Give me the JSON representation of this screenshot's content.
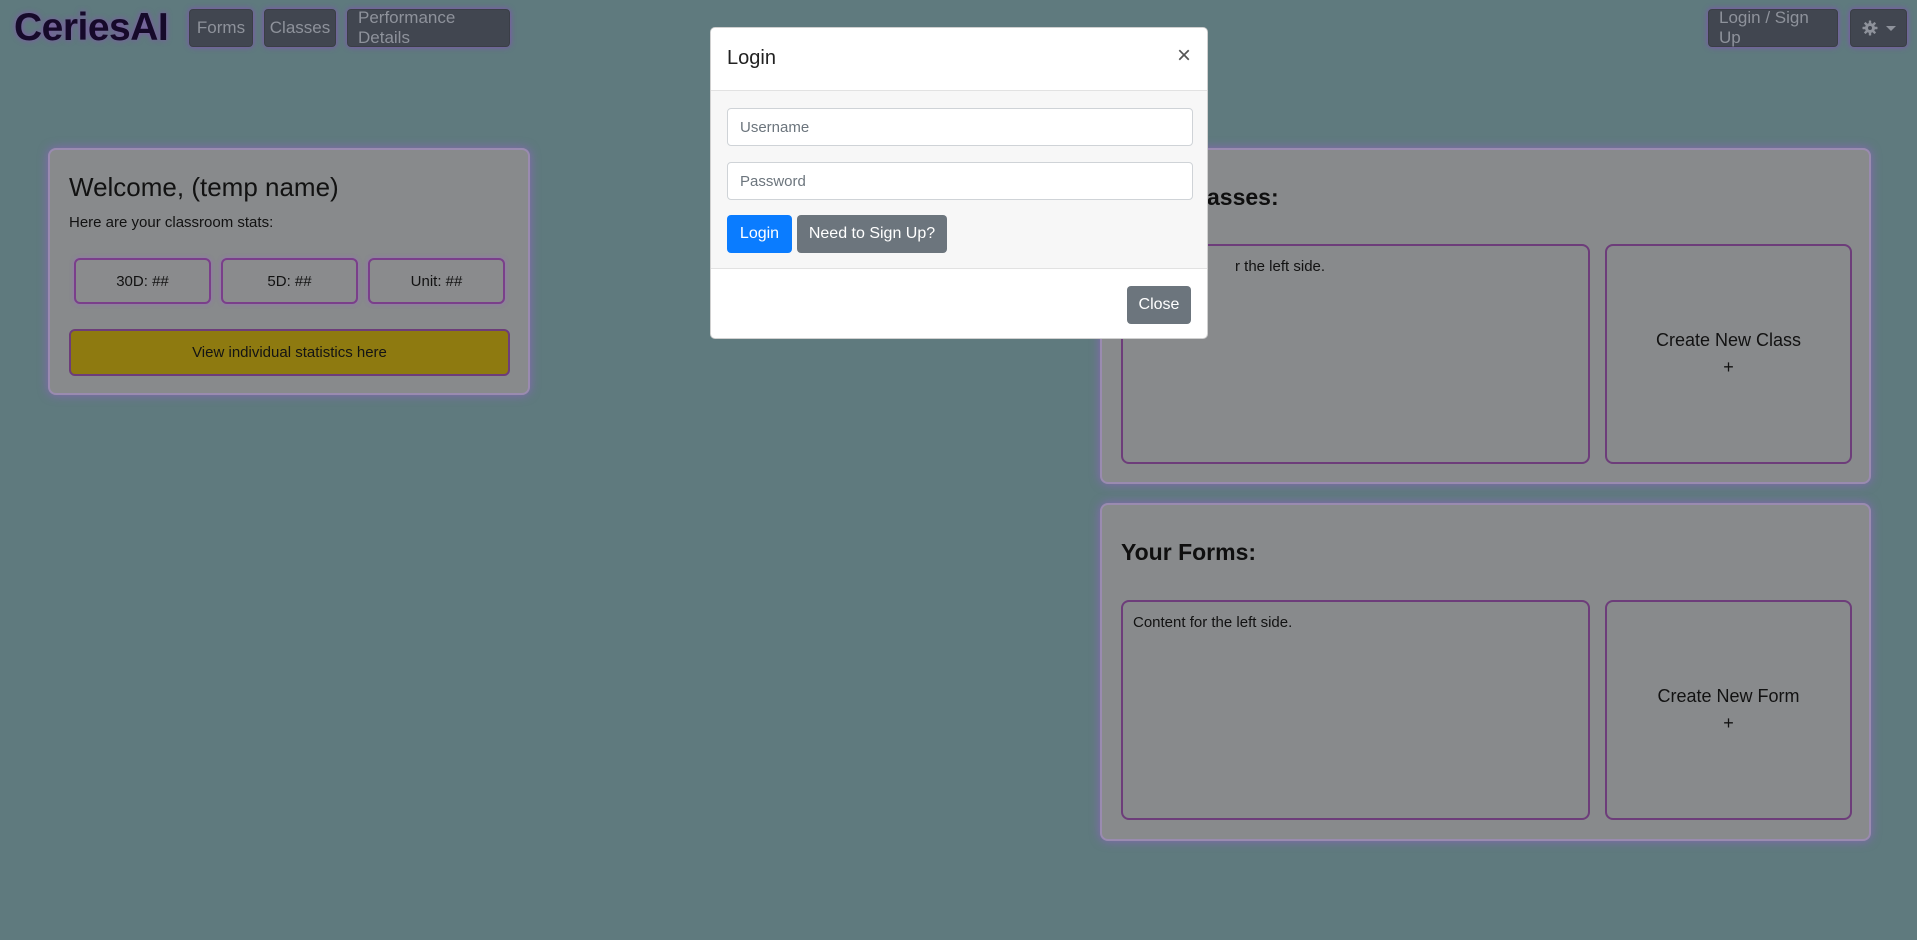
{
  "nav": {
    "brand": "CeriesAI",
    "items": [
      "Forms",
      "Classes",
      "Performance Details"
    ],
    "login_signup": "Login / Sign Up",
    "settings_icon": "gear-icon"
  },
  "welcome": {
    "title": "Welcome, (temp name)",
    "subtitle": "Here are your classroom stats:",
    "stats": [
      "30D: ##",
      "5D: ##",
      "Unit: ##"
    ],
    "view_button": "View individual statistics here"
  },
  "classes": {
    "title_visible": "asses:",
    "content_visible": "r the left side.",
    "create_label": "Create New Class",
    "create_plus": "+"
  },
  "forms": {
    "title": "Your Forms:",
    "content": "Content for the left side.",
    "create_label": "Create New Form",
    "create_plus": "+"
  },
  "modal": {
    "title": "Login",
    "close_glyph": "×",
    "username_placeholder": "Username",
    "password_placeholder": "Password",
    "login_button": "Login",
    "signup_button": "Need to Sign Up?",
    "close_button": "Close"
  },
  "colors": {
    "backdrop": "#5f7a7e",
    "primary": "#0a7cff",
    "secondary": "#6c757d",
    "accent_glow": "#a05ae6",
    "highlight": "#8e7a10"
  }
}
